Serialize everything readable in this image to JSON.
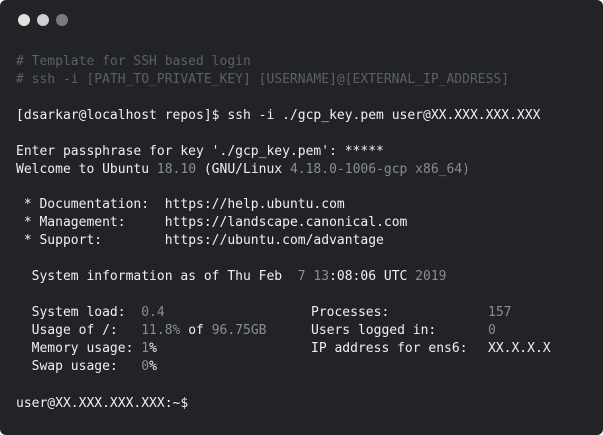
{
  "window": {
    "background": "#212327",
    "dot_colors": [
      "#e2e2e2",
      "#cfcfcf",
      "#7b7b7b"
    ]
  },
  "terminal": {
    "comment1": "# Template for SSH based login",
    "comment2": "# ssh -i [PATH_TO_PRIVATE_KEY] [USERNAME]@[EXTERNAL_IP_ADDRESS]",
    "prompt1": "[dsarkar@localhost repos]$ ",
    "command1": "ssh -i ./gcp_key.pem user@XX.XXX.XXX.XXX",
    "passphrase": "Enter passphrase for key './gcp_key.pem': *****",
    "welcome": {
      "pre": "Welcome to Ubuntu ",
      "version": "18.10",
      "mid": " (GNU/Linux ",
      "kernel": "4.18.0-1006-gcp x86_64)"
    },
    "doc_label": " * Documentation:  ",
    "doc_url": "https://help.ubuntu.com",
    "mgmt_label": " * Management:     ",
    "mgmt_url": "https://landscape.canonical.com",
    "support_label": " * Support:        ",
    "support_url": "https://ubuntu.com/advantage",
    "sysinfo": {
      "pre": "  System information as of Thu Feb  ",
      "day": "7",
      "time_a": " 13",
      "time_b": ":08:06 UTC ",
      "year": "2019"
    },
    "stats": {
      "system_load_label": "  System load:  ",
      "system_load_value": "0.4",
      "processes_label": "Processes:",
      "processes_value": "157",
      "usage_label": "  Usage of /:   ",
      "usage_value_a": "11.8%",
      "usage_value_mid": " of ",
      "usage_value_b": "96.75GB",
      "users_label": "Users logged in:",
      "users_value": "0",
      "memory_label": "  Memory usage: ",
      "memory_value_a": "1",
      "memory_value_b": "%",
      "ip_label": "IP address for ens6:",
      "ip_value": "XX.X.X.X",
      "swap_label": "  Swap usage:   ",
      "swap_value_a": "0",
      "swap_value_b": "%"
    },
    "final_prompt": "user@XX.XXX.XXX.XXX:~$"
  }
}
